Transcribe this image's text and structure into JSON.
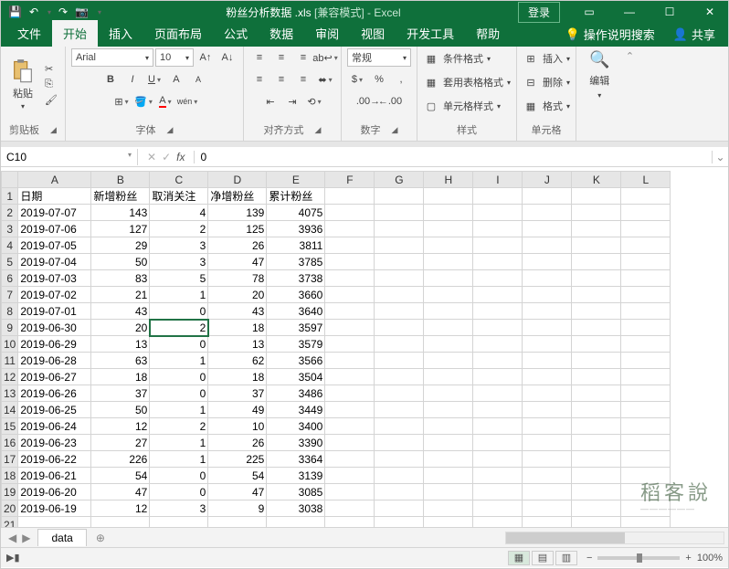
{
  "qat": {
    "save": "💾",
    "undo": "↶",
    "redo": "↷",
    "camera": "📷"
  },
  "title": {
    "filename": "粉丝分析数据 .xls",
    "compat": "[兼容模式]",
    "app": "Excel"
  },
  "login": "登录",
  "tabs": {
    "file": "文件",
    "home": "开始",
    "insert": "插入",
    "layout": "页面布局",
    "formulas": "公式",
    "data": "数据",
    "review": "审阅",
    "view": "视图",
    "dev": "开发工具",
    "help": "帮助",
    "tellme": "操作说明搜索",
    "share": "共享"
  },
  "ribbon": {
    "clipboard": {
      "label": "剪贴板",
      "paste": "粘贴"
    },
    "font": {
      "label": "字体",
      "name": "Arial",
      "size": "10"
    },
    "align": {
      "label": "对齐方式"
    },
    "number": {
      "label": "数字",
      "format": "常规"
    },
    "styles": {
      "label": "样式",
      "conditional": "条件格式",
      "table": "套用表格格式",
      "cell": "单元格样式"
    },
    "cells": {
      "label": "单元格",
      "insert": "插入",
      "delete": "删除",
      "format": "格式"
    },
    "edit": {
      "label": "编辑"
    }
  },
  "namebox": "C10",
  "formula": "0",
  "columns": [
    "A",
    "B",
    "C",
    "D",
    "E",
    "F",
    "G",
    "H",
    "I",
    "J",
    "K",
    "L"
  ],
  "headers": [
    "日期",
    "新增粉丝",
    "取消关注",
    "净增粉丝",
    "累计粉丝"
  ],
  "rows": [
    [
      "2019-07-07",
      "143",
      "4",
      "139",
      "4075"
    ],
    [
      "2019-07-06",
      "127",
      "2",
      "125",
      "3936"
    ],
    [
      "2019-07-05",
      "29",
      "3",
      "26",
      "3811"
    ],
    [
      "2019-07-04",
      "50",
      "3",
      "47",
      "3785"
    ],
    [
      "2019-07-03",
      "83",
      "5",
      "78",
      "3738"
    ],
    [
      "2019-07-02",
      "21",
      "1",
      "20",
      "3660"
    ],
    [
      "2019-07-01",
      "43",
      "0",
      "43",
      "3640"
    ],
    [
      "2019-06-30",
      "20",
      "2",
      "18",
      "3597"
    ],
    [
      "2019-06-29",
      "13",
      "0",
      "13",
      "3579"
    ],
    [
      "2019-06-28",
      "63",
      "1",
      "62",
      "3566"
    ],
    [
      "2019-06-27",
      "18",
      "0",
      "18",
      "3504"
    ],
    [
      "2019-06-26",
      "37",
      "0",
      "37",
      "3486"
    ],
    [
      "2019-06-25",
      "50",
      "1",
      "49",
      "3449"
    ],
    [
      "2019-06-24",
      "12",
      "2",
      "10",
      "3400"
    ],
    [
      "2019-06-23",
      "27",
      "1",
      "26",
      "3390"
    ],
    [
      "2019-06-22",
      "226",
      "1",
      "225",
      "3364"
    ],
    [
      "2019-06-21",
      "54",
      "0",
      "54",
      "3139"
    ],
    [
      "2019-06-20",
      "47",
      "0",
      "47",
      "3085"
    ],
    [
      "2019-06-19",
      "12",
      "3",
      "9",
      "3038"
    ]
  ],
  "sel": {
    "row": 9,
    "col": 2
  },
  "sheet": {
    "name": "data"
  },
  "zoomlabel": "100%",
  "watermark": {
    "main": "稻客說",
    "sub": "——————"
  }
}
